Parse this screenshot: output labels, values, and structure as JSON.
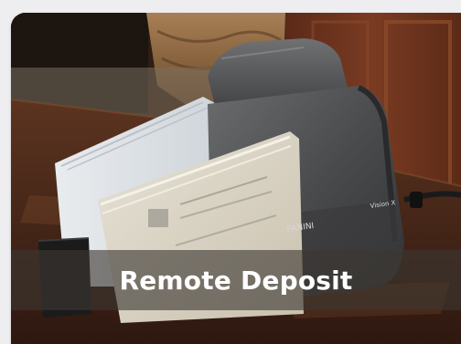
{
  "tile": {
    "caption": "Remote Deposit",
    "image_subject": "check scanner with checks on a wooden desk",
    "scanner_brand": "PANINI",
    "scanner_model": "Vision X"
  }
}
